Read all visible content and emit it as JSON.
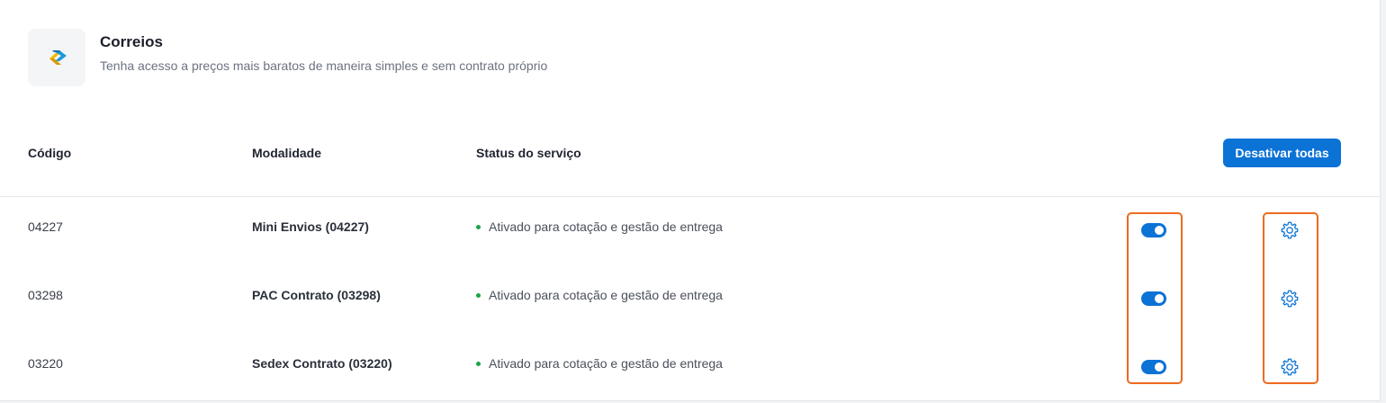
{
  "header": {
    "title": "Correios",
    "subtitle": "Tenha acesso a preços mais baratos de maneira simples e sem contrato próprio",
    "logo_icon": "correios-logo-icon"
  },
  "table": {
    "columns": {
      "code": "Código",
      "modality": "Modalidade",
      "status": "Status do serviço"
    },
    "deactivate_all_label": "Desativar todas",
    "rows": [
      {
        "code": "04227",
        "modality": "Mini Envios (04227)",
        "status": "Ativado para cotação e gestão de entrega",
        "enabled": true
      },
      {
        "code": "03298",
        "modality": "PAC Contrato (03298)",
        "status": "Ativado para cotação e gestão de entrega",
        "enabled": true
      },
      {
        "code": "03220",
        "modality": "Sedex Contrato (03220)",
        "status": "Ativado para cotação e gestão de entrega",
        "enabled": true
      }
    ]
  },
  "colors": {
    "accent": "#0b72d6",
    "status_active": "#1fa34a",
    "highlight": "#ee6a1f"
  }
}
